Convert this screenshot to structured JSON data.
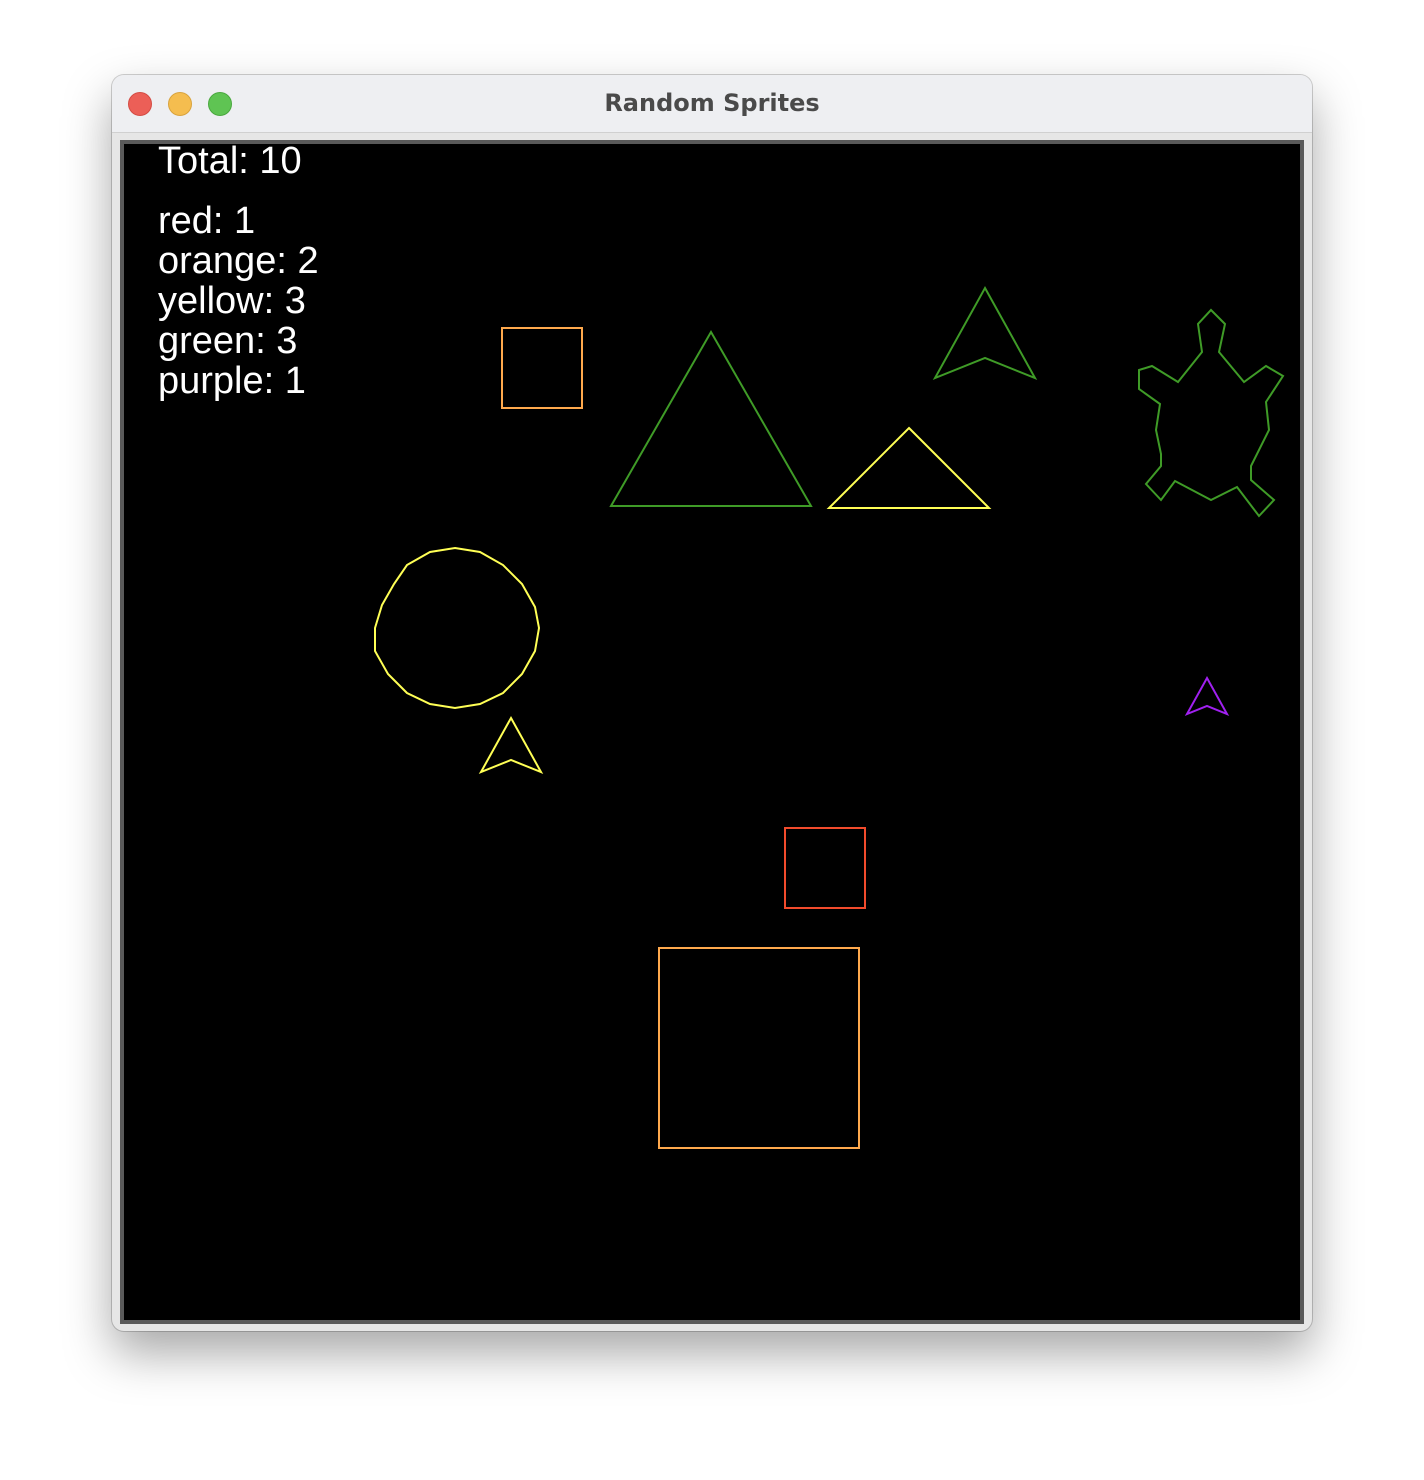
{
  "window": {
    "title": "Random Sprites"
  },
  "hud": {
    "total_label": "Total: 10",
    "counts": [
      {
        "label": "red: 1"
      },
      {
        "label": "orange: 2"
      },
      {
        "label": "yellow: 3"
      },
      {
        "label": "green: 3"
      },
      {
        "label": "purple: 1"
      }
    ]
  },
  "colors": {
    "red": "#f24b2c",
    "orange": "#ffa94d",
    "yellow": "#ffff55",
    "green": "#3f9b27",
    "purple": "#a020f0",
    "canvas_bg": "#000000",
    "text": "#ffffff"
  },
  "sprites": [
    {
      "kind": "square",
      "color": "orange",
      "icon": "square-icon"
    },
    {
      "kind": "triangle",
      "color": "green",
      "icon": "triangle-icon"
    },
    {
      "kind": "arrow",
      "color": "green",
      "icon": "arrow-icon"
    },
    {
      "kind": "turtle",
      "color": "green",
      "icon": "turtle-icon"
    },
    {
      "kind": "triangle",
      "color": "yellow",
      "icon": "triangle-icon"
    },
    {
      "kind": "circle",
      "color": "yellow",
      "icon": "circle-icon"
    },
    {
      "kind": "arrow",
      "color": "yellow",
      "icon": "arrow-icon"
    },
    {
      "kind": "arrow",
      "color": "purple",
      "icon": "arrow-icon"
    },
    {
      "kind": "square",
      "color": "red",
      "icon": "square-icon"
    },
    {
      "kind": "square",
      "color": "orange",
      "icon": "square-icon"
    }
  ]
}
